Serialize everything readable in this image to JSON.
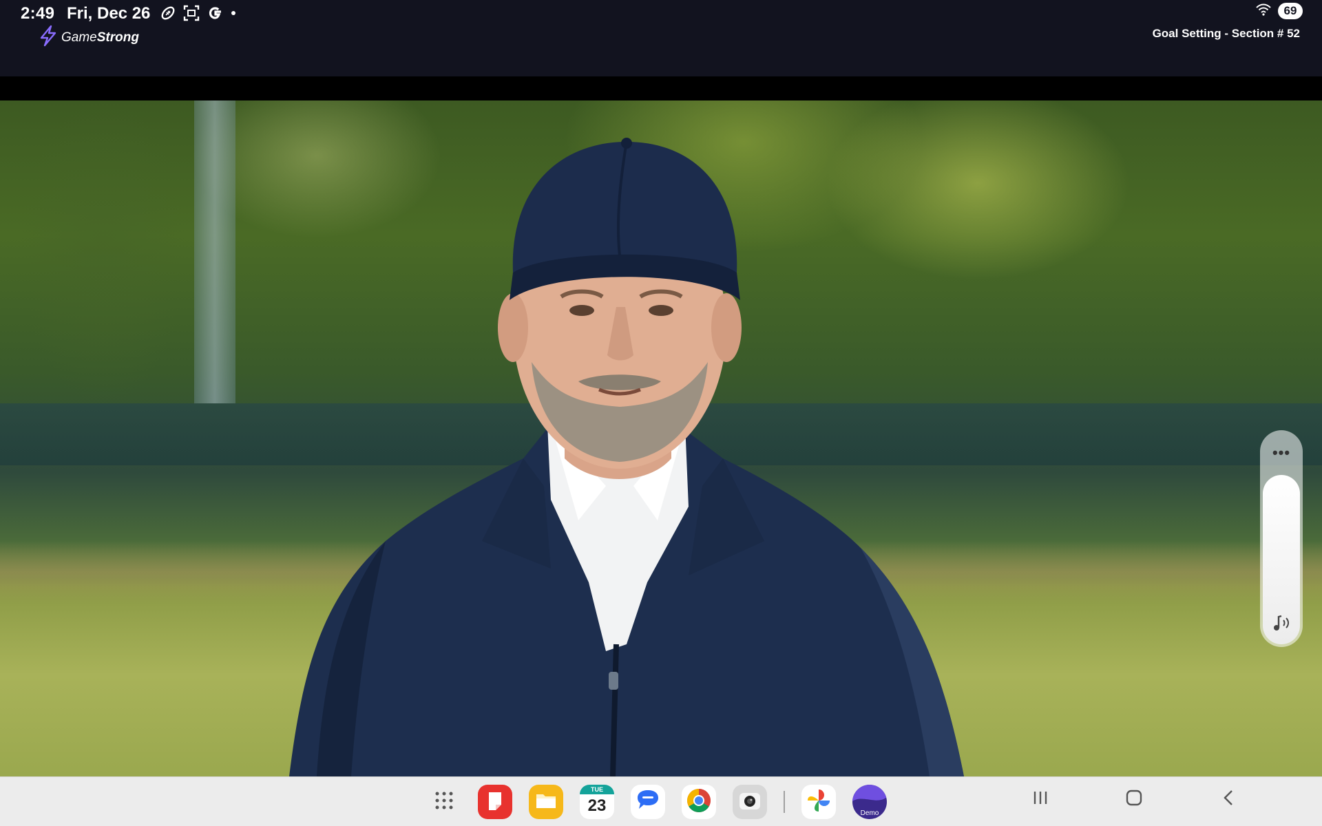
{
  "status_bar": {
    "time": "2:49",
    "date": "Fri, Dec 26",
    "notification_icons": [
      "football-icon",
      "screenshot-icon",
      "google-icon",
      "dot-icon"
    ],
    "battery_level": "69",
    "wifi": "wifi-icon"
  },
  "app": {
    "brand_prefix": "Game",
    "brand_suffix": "Strong",
    "brand_icon": "lightning-bolt-icon",
    "accent_color": "#8a6dff",
    "section_title": "Goal Setting - Section # 52"
  },
  "volume": {
    "more_label": "•••",
    "level_fraction": 0.8,
    "icon": "music-note-volume-icon"
  },
  "taskbar": {
    "apps": [
      {
        "name": "app-drawer",
        "icon": "grid-icon"
      },
      {
        "name": "notes",
        "icon": "notes-icon",
        "color": "#e8322e"
      },
      {
        "name": "files",
        "icon": "folder-icon",
        "color": "#f6b81a"
      },
      {
        "name": "calendar",
        "icon": "calendar-icon",
        "day_label": "TUE",
        "day_number": "23"
      },
      {
        "name": "messages",
        "icon": "chat-bubble-icon",
        "color": "#2d6df5"
      },
      {
        "name": "chrome",
        "icon": "chrome-icon"
      },
      {
        "name": "camera",
        "icon": "camera-icon"
      },
      {
        "name": "photos",
        "icon": "pinwheel-icon"
      },
      {
        "name": "demo",
        "icon": "demo-app-icon",
        "label": "Demo"
      }
    ],
    "nav": [
      "recents-icon",
      "home-icon",
      "back-icon"
    ]
  }
}
